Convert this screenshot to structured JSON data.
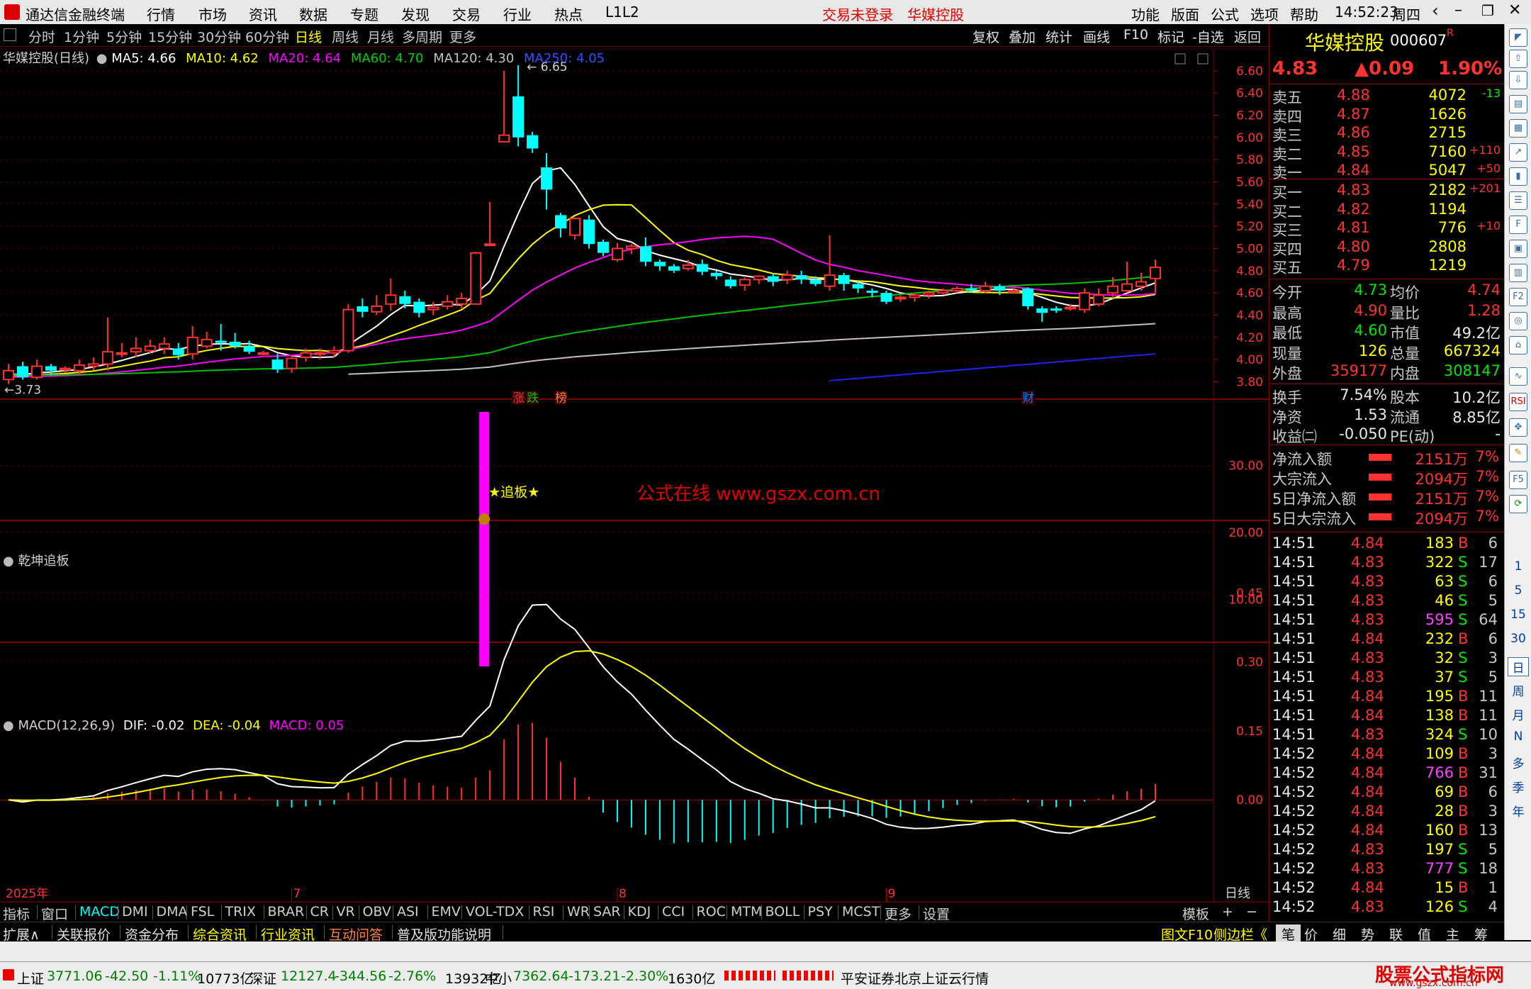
{
  "titlebar": {
    "app": "通达信金融终端",
    "menu": [
      "行情",
      "市场",
      "资讯",
      "数据",
      "专题",
      "发现",
      "交易",
      "行业",
      "热点",
      "L1L2"
    ],
    "login": "交易未登录",
    "stock_name": "华媒控股",
    "right_menu": [
      "功能",
      "版面",
      "公式",
      "选项",
      "帮助"
    ],
    "time": "14:52:23",
    "weekday": "周四"
  },
  "periods": [
    "分时",
    "1分钟",
    "5分钟",
    "15分钟",
    "30分钟",
    "60分钟",
    "日线",
    "周线",
    "月线",
    "多周期",
    "更多"
  ],
  "active_period": "日线",
  "tools": [
    "复权",
    "叠加",
    "统计",
    "画线",
    "F10",
    "标记",
    "-自选",
    "返回"
  ],
  "main_legend": {
    "title": "华媒控股(日线)",
    "ma5": "MA5: 4.66",
    "ma10": "MA10: 4.62",
    "ma20": "MA20: 4.64",
    "ma60": "MA60: 4.70",
    "ma120": "MA120: 4.30",
    "ma250": "MA250: 4.05"
  },
  "colors": {
    "up": "#ff3232",
    "down": "#00ffff",
    "ma5": "#ffffff",
    "ma10": "#ffff00",
    "ma20": "#ff00ff",
    "ma60": "#00c000",
    "ma120": "#c0c0c0",
    "ma250": "#2020ff",
    "grid": "#7a0000"
  },
  "chart_data": [
    {
      "type": "candlestick",
      "name": "main",
      "yticks": [
        "6.60",
        "6.40",
        "6.20",
        "6.00",
        "5.80",
        "5.60",
        "5.40",
        "5.20",
        "5.00",
        "4.80",
        "4.60",
        "4.40",
        "4.20",
        "4.00",
        "3.80"
      ],
      "ylim": [
        3.72,
        6.72
      ],
      "high_label": "6.65",
      "low_label": "3.73",
      "candles": [
        [
          3.82,
          3.9,
          3.78,
          3.96
        ],
        [
          3.94,
          3.84,
          3.82,
          3.98
        ],
        [
          3.84,
          3.94,
          3.82,
          4.0
        ],
        [
          3.94,
          3.9,
          3.86,
          3.96
        ],
        [
          3.92,
          3.92,
          3.88,
          3.94
        ],
        [
          3.9,
          3.95,
          3.86,
          4.0
        ],
        [
          3.94,
          3.96,
          3.9,
          4.02
        ],
        [
          3.96,
          4.07,
          3.9,
          4.38
        ],
        [
          4.05,
          4.06,
          4.02,
          4.15
        ],
        [
          4.07,
          4.1,
          4.02,
          4.2
        ],
        [
          4.08,
          4.12,
          4.05,
          4.18
        ],
        [
          4.1,
          4.14,
          4.05,
          4.2
        ],
        [
          4.1,
          4.04,
          4.0,
          4.15
        ],
        [
          4.05,
          4.2,
          4.0,
          4.3
        ],
        [
          4.12,
          4.18,
          4.1,
          4.25
        ],
        [
          4.17,
          4.15,
          4.08,
          4.32
        ],
        [
          4.16,
          4.12,
          4.1,
          4.24
        ],
        [
          4.12,
          4.07,
          4.05,
          4.17
        ],
        [
          4.06,
          4.06,
          4.04,
          4.08
        ],
        [
          4.0,
          3.91,
          3.88,
          4.05
        ],
        [
          3.92,
          4.01,
          3.88,
          4.04
        ],
        [
          4.02,
          4.06,
          3.98,
          4.1
        ],
        [
          4.05,
          4.06,
          4.0,
          4.1
        ],
        [
          4.06,
          4.08,
          4.02,
          4.12
        ],
        [
          4.08,
          4.45,
          4.06,
          4.5
        ],
        [
          4.48,
          4.43,
          4.38,
          4.55
        ],
        [
          4.43,
          4.48,
          4.4,
          4.58
        ],
        [
          4.5,
          4.58,
          4.44,
          4.73
        ],
        [
          4.57,
          4.5,
          4.46,
          4.62
        ],
        [
          4.52,
          4.42,
          4.38,
          4.55
        ],
        [
          4.45,
          4.47,
          4.4,
          4.52
        ],
        [
          4.48,
          4.52,
          4.45,
          4.58
        ],
        [
          4.5,
          4.55,
          4.46,
          4.6
        ],
        [
          4.5,
          4.96,
          4.5,
          4.97
        ],
        [
          5.04,
          5.04,
          5.04,
          5.42
        ],
        [
          5.96,
          6.02,
          5.96,
          6.6
        ],
        [
          6.37,
          6.0,
          5.92,
          6.65
        ],
        [
          6.02,
          5.9,
          5.86,
          6.05
        ],
        [
          5.73,
          5.53,
          5.35,
          5.86
        ],
        [
          5.3,
          5.18,
          5.1,
          5.32
        ],
        [
          5.12,
          5.27,
          5.08,
          5.28
        ],
        [
          5.26,
          5.04,
          5.0,
          5.3
        ],
        [
          5.06,
          4.96,
          4.93,
          5.08
        ],
        [
          4.9,
          5.0,
          4.88,
          5.05
        ],
        [
          5.0,
          5.02,
          4.95,
          5.04
        ],
        [
          5.02,
          4.88,
          4.84,
          5.1
        ],
        [
          4.88,
          4.84,
          4.8,
          4.9
        ],
        [
          4.84,
          4.8,
          4.78,
          4.86
        ],
        [
          4.82,
          4.85,
          4.8,
          4.9
        ],
        [
          4.86,
          4.79,
          4.76,
          4.9
        ],
        [
          4.78,
          4.75,
          4.72,
          4.8
        ],
        [
          4.72,
          4.66,
          4.64,
          4.75
        ],
        [
          4.67,
          4.72,
          4.62,
          4.74
        ],
        [
          4.72,
          4.75,
          4.68,
          4.76
        ],
        [
          4.75,
          4.7,
          4.66,
          4.78
        ],
        [
          4.72,
          4.76,
          4.68,
          4.8
        ],
        [
          4.76,
          4.72,
          4.68,
          4.8
        ],
        [
          4.72,
          4.68,
          4.66,
          4.75
        ],
        [
          4.66,
          4.76,
          4.62,
          5.12
        ],
        [
          4.76,
          4.68,
          4.62,
          4.78
        ],
        [
          4.68,
          4.64,
          4.6,
          4.7
        ],
        [
          4.62,
          4.6,
          4.56,
          4.64
        ],
        [
          4.6,
          4.52,
          4.5,
          4.62
        ],
        [
          4.55,
          4.56,
          4.52,
          4.58
        ],
        [
          4.56,
          4.58,
          4.52,
          4.6
        ],
        [
          4.58,
          4.6,
          4.55,
          4.62
        ],
        [
          4.6,
          4.62,
          4.58,
          4.64
        ],
        [
          4.62,
          4.64,
          4.6,
          4.66
        ],
        [
          4.64,
          4.62,
          4.6,
          4.68
        ],
        [
          4.62,
          4.66,
          4.6,
          4.7
        ],
        [
          4.66,
          4.62,
          4.58,
          4.68
        ],
        [
          4.62,
          4.62,
          4.6,
          4.66
        ],
        [
          4.64,
          4.48,
          4.45,
          4.65
        ],
        [
          4.46,
          4.42,
          4.34,
          4.48
        ],
        [
          4.46,
          4.44,
          4.42,
          4.48
        ],
        [
          4.47,
          4.47,
          4.44,
          4.5
        ],
        [
          4.45,
          4.6,
          4.42,
          4.64
        ],
        [
          4.5,
          4.58,
          4.48,
          4.64
        ],
        [
          4.6,
          4.66,
          4.55,
          4.74
        ],
        [
          4.62,
          4.68,
          4.6,
          4.88
        ],
        [
          4.66,
          4.7,
          4.62,
          4.78
        ],
        [
          4.73,
          4.83,
          4.6,
          4.9
        ]
      ],
      "markers": [
        "涨",
        "跌",
        "榜",
        "财"
      ],
      "watermark": "公式在线 www.gszx.com.cn"
    },
    {
      "type": "bar",
      "name": "乾坤追板",
      "yticks": [
        "30.00",
        "20.00",
        "10.00"
      ],
      "ylim": [
        0,
        38
      ],
      "bar_index": 33,
      "value": 38,
      "label": "★追板★"
    },
    {
      "type": "macd",
      "name": "MACD(12,26,9)",
      "dif": "DIF: -0.02",
      "dea": "DEA: -0.04",
      "macd": "MACD: 0.05",
      "yticks": [
        "0.45",
        "0.30",
        "0.15",
        "0.00"
      ],
      "ylim": [
        -0.12,
        0.5
      ]
    }
  ],
  "xaxis": {
    "year": "2025年",
    "months": [
      "7",
      "8",
      "9"
    ],
    "period_label": "日线"
  },
  "quote": {
    "name": "华媒控股",
    "code": "000607",
    "flag": "R",
    "price": "4.83",
    "change": "▲0.09",
    "pct": "1.90%",
    "asks": [
      {
        "label": "卖五",
        "price": "4.88",
        "vol": "4072",
        "chg": "-13"
      },
      {
        "label": "卖四",
        "price": "4.87",
        "vol": "1626",
        "chg": ""
      },
      {
        "label": "卖三",
        "price": "4.86",
        "vol": "2715",
        "chg": ""
      },
      {
        "label": "卖二",
        "price": "4.85",
        "vol": "7160",
        "chg": "+110"
      },
      {
        "label": "卖一",
        "price": "4.84",
        "vol": "5047",
        "chg": "+50"
      }
    ],
    "bids": [
      {
        "label": "买一",
        "price": "4.83",
        "vol": "2182",
        "chg": "+201"
      },
      {
        "label": "买二",
        "price": "4.82",
        "vol": "1194",
        "chg": ""
      },
      {
        "label": "买三",
        "price": "4.81",
        "vol": "776",
        "chg": "+10"
      },
      {
        "label": "买四",
        "price": "4.80",
        "vol": "2808",
        "chg": ""
      },
      {
        "label": "买五",
        "price": "4.79",
        "vol": "1219",
        "chg": ""
      }
    ],
    "stats": [
      [
        "今开",
        "4.73",
        "均价",
        "4.74"
      ],
      [
        "最高",
        "4.90",
        "量比",
        "1.28"
      ],
      [
        "最低",
        "4.60",
        "市值",
        "49.2亿"
      ],
      [
        "现量",
        "126",
        "总量",
        "667324"
      ],
      [
        "外盘",
        "359177",
        "内盘",
        "308147"
      ]
    ],
    "fund": [
      [
        "换手",
        "7.54%",
        "股本",
        "10.2亿"
      ],
      [
        "净资",
        "1.53",
        "流通",
        "8.85亿"
      ],
      [
        "收益㈡",
        "-0.050",
        "PE(动)",
        "-"
      ]
    ],
    "flows": [
      {
        "label": "净流入额",
        "val": "2151万",
        "pct": "7%"
      },
      {
        "label": "大宗流入",
        "val": "2094万",
        "pct": "7%"
      },
      {
        "label": "5日净流入额",
        "val": "2151万",
        "pct": "7%"
      },
      {
        "label": "5日大宗流入",
        "val": "2094万",
        "pct": "7%"
      }
    ],
    "ticks": [
      [
        "14:51",
        "4.84",
        "183",
        "B",
        "6"
      ],
      [
        "14:51",
        "4.83",
        "322",
        "S",
        "17"
      ],
      [
        "14:51",
        "4.83",
        "63",
        "S",
        "6"
      ],
      [
        "14:51",
        "4.83",
        "46",
        "S",
        "5"
      ],
      [
        "14:51",
        "4.83",
        "595",
        "S",
        "64"
      ],
      [
        "14:51",
        "4.84",
        "232",
        "B",
        "6"
      ],
      [
        "14:51",
        "4.83",
        "32",
        "S",
        "3"
      ],
      [
        "14:51",
        "4.83",
        "37",
        "S",
        "5"
      ],
      [
        "14:51",
        "4.84",
        "195",
        "B",
        "11"
      ],
      [
        "14:51",
        "4.84",
        "138",
        "B",
        "11"
      ],
      [
        "14:51",
        "4.83",
        "324",
        "S",
        "10"
      ],
      [
        "14:52",
        "4.84",
        "109",
        "B",
        "3"
      ],
      [
        "14:52",
        "4.84",
        "766",
        "B",
        "31"
      ],
      [
        "14:52",
        "4.84",
        "69",
        "B",
        "6"
      ],
      [
        "14:52",
        "4.84",
        "28",
        "B",
        "3"
      ],
      [
        "14:52",
        "4.84",
        "160",
        "B",
        "13"
      ],
      [
        "14:52",
        "4.83",
        "197",
        "S",
        "5"
      ],
      [
        "14:52",
        "4.83",
        "777",
        "S",
        "18"
      ],
      [
        "14:52",
        "4.84",
        "15",
        "B",
        "1"
      ],
      [
        "14:52",
        "4.83",
        "126",
        "S",
        "4"
      ]
    ]
  },
  "icon_labels": [
    "1",
    "5",
    "15",
    "30",
    "日",
    "周",
    "月",
    "N",
    "多",
    "季",
    "年"
  ],
  "indicator_tabs": [
    "指标",
    "窗口",
    "MACD",
    "DMI",
    "DMA",
    "FSL",
    "TRIX",
    "BRAR",
    "CR",
    "VR",
    "OBV",
    "ASI",
    "EMV",
    "VOL-TDX",
    "RSI",
    "WR",
    "SAR",
    "KDJ",
    "CCI",
    "ROC",
    "MTM",
    "BOLL",
    "PSY",
    "MCST",
    "更多",
    "设置"
  ],
  "tab_template": "模板",
  "bottom_tabs": [
    "扩展∧",
    "关联报价",
    "资金分布",
    "综合资讯",
    "行业资讯",
    "互动问答",
    "普及版功能说明"
  ],
  "bottom_right": [
    "图文F10",
    "侧边栏《"
  ],
  "right_tabs": [
    "笔",
    "价",
    "细",
    "势",
    "联",
    "值",
    "主",
    "筹"
  ],
  "status": {
    "sh_label": "上证",
    "sh_val": "3771.06",
    "sh_chg": "-42.50",
    "sh_pct": "-1.11%",
    "sh_amt": "10773亿",
    "sz_label": "深证",
    "sz_val": "12127.4",
    "sz_chg": "-344.56",
    "sz_pct": "-2.76%",
    "sz_amt": "13932亿",
    "zx_label": "中小",
    "zx_val": "7362.64",
    "zx_chg": "-173.21",
    "zx_pct": "-2.30%",
    "zx_amt": "1630亿",
    "server": "平安证券北京上证云行情",
    "brand": "股票公式指标网",
    "brand_url": "www.gszx.com.cn"
  }
}
